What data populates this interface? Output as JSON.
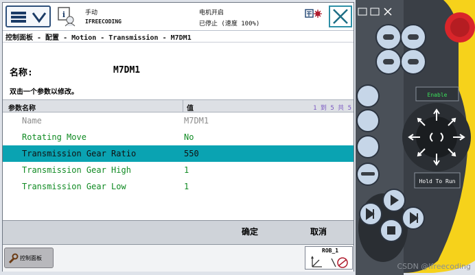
{
  "status": {
    "mode": "手动",
    "controller": "IFREECODING",
    "motors": "电机开启",
    "state": "已停止 (速度 100%)"
  },
  "breadcrumb": "控制面板 - 配置 - Motion - Transmission - M7DM1",
  "name_label": "名称:",
  "name_value": "M7DM1",
  "instruction": "双击一个参数以修改。",
  "table": {
    "col_name": "参数名称",
    "col_value": "值",
    "range": "1 到 5 共 5",
    "rows": [
      {
        "name": "Name",
        "value": "M7DM1",
        "selected": false,
        "editable": false
      },
      {
        "name": "Rotating Move",
        "value": "No",
        "selected": false,
        "editable": true
      },
      {
        "name": "Transmission Gear Ratio",
        "value": "550",
        "selected": true,
        "editable": true
      },
      {
        "name": "Transmission Gear High",
        "value": "1",
        "selected": false,
        "editable": true
      },
      {
        "name": "Transmission Gear Low",
        "value": "1",
        "selected": false,
        "editable": true
      }
    ]
  },
  "buttons": {
    "ok": "确定",
    "cancel": "取消"
  },
  "taskbar": {
    "control_panel": "控制面板",
    "robot": "ROB_1"
  },
  "pendant": {
    "enable": "Enable",
    "hold_to_run": "Hold To Run"
  },
  "watermark": "CSDN @Ifreecoding",
  "colors": {
    "selected_row": "#0aa3b2",
    "value_green": "#0f8a22",
    "pendant_yellow": "#f6d21b",
    "estop_red": "#d9252a"
  }
}
